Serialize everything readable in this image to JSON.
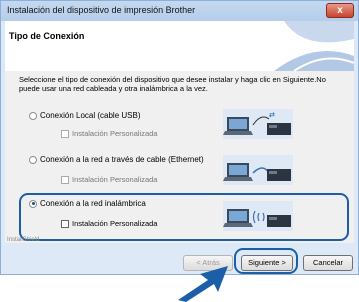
{
  "window": {
    "title": "Instalación del dispositivo de impresión Brother",
    "close_label": "x"
  },
  "header": {
    "title": "Tipo de Conexión"
  },
  "content": {
    "instruction": "Seleccione el tipo de conexión del dispositivo que desee instalar y haga clic en Siguiente.No puede usar una red cableada y otra inalámbrica a la vez.",
    "options": [
      {
        "label": "Conexión Local (cable USB)",
        "selected": false,
        "custom_install": {
          "label": "Instalación Personalizada",
          "checked": false,
          "enabled": false
        }
      },
      {
        "label": "Conexión a la red a través de cable (Ethernet)",
        "selected": false,
        "custom_install": {
          "label": "Instalación Personalizada",
          "checked": false,
          "enabled": false
        }
      },
      {
        "label": "Conexión a la red inalámbrica",
        "selected": true,
        "custom_install": {
          "label": "Instalación Personalizada",
          "checked": false,
          "enabled": true
        }
      }
    ]
  },
  "footer": {
    "watermark": "InstallShield",
    "back_label": "< Atrás",
    "next_label": "Siguiente >",
    "cancel_label": "Cancelar"
  },
  "colors": {
    "highlight": "#1c5fa8",
    "window_frame": "#dde9f6"
  }
}
